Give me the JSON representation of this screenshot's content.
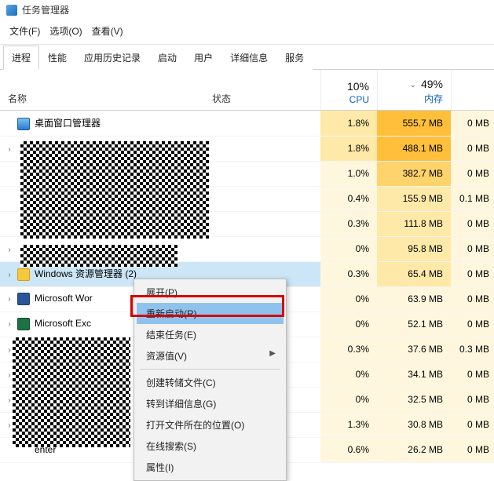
{
  "window": {
    "title": "任务管理器"
  },
  "menubar": {
    "file": "文件(F)",
    "options": "选项(O)",
    "view": "查看(V)"
  },
  "tabs": {
    "processes": "进程",
    "performance": "性能",
    "app_history": "应用历史记录",
    "startup": "启动",
    "users": "用户",
    "details": "详细信息",
    "services": "服务"
  },
  "columns": {
    "name": "名称",
    "status": "状态",
    "cpu_pct": "10%",
    "cpu_label": "CPU",
    "mem_pct": "49%",
    "mem_label": "内存"
  },
  "processes": [
    {
      "name": "桌面窗口管理器",
      "icon": "desktop",
      "exp": "",
      "cpu": "1.8%",
      "mem": "555.7 MB",
      "disk": "0 MB",
      "cpu_heat": "heat-mid",
      "mem_heat": "heat-vhigh",
      "disk_heat": "heat-low"
    },
    {
      "name": "",
      "icon": "",
      "exp": "›",
      "cpu": "1.8%",
      "mem": "488.1 MB",
      "disk": "0 MB",
      "cpu_heat": "heat-mid",
      "mem_heat": "heat-vhigh",
      "disk_heat": "heat-low"
    },
    {
      "name": "",
      "icon": "",
      "exp": "",
      "cpu": "1.0%",
      "mem": "382.7 MB",
      "disk": "0 MB",
      "cpu_heat": "heat-low",
      "mem_heat": "heat-high",
      "disk_heat": "heat-low"
    },
    {
      "name": "",
      "icon": "",
      "exp": "",
      "cpu": "0.4%",
      "mem": "155.9 MB",
      "disk": "0.1 MB",
      "cpu_heat": "heat-low",
      "mem_heat": "heat-mid",
      "disk_heat": "heat-low"
    },
    {
      "name": "",
      "icon": "",
      "exp": "",
      "cpu": "0.3%",
      "mem": "111.8 MB",
      "disk": "0 MB",
      "cpu_heat": "heat-low",
      "mem_heat": "heat-mid",
      "disk_heat": "heat-low"
    },
    {
      "name": "",
      "icon": "",
      "exp": "›",
      "cpu": "0%",
      "mem": "95.8 MB",
      "disk": "0 MB",
      "cpu_heat": "heat-low",
      "mem_heat": "heat-mid",
      "disk_heat": "heat-low"
    },
    {
      "name": "Windows 资源管理器 (2)",
      "icon": "explorer",
      "exp": "›",
      "cpu": "0.3%",
      "mem": "65.4 MB",
      "disk": "0 MB",
      "cpu_heat": "heat-low",
      "mem_heat": "heat-mid",
      "disk_heat": "heat-low"
    },
    {
      "name": "Microsoft Wor",
      "icon": "word",
      "exp": "›",
      "cpu": "0%",
      "mem": "63.9 MB",
      "disk": "0 MB",
      "cpu_heat": "heat-low",
      "mem_heat": "heat-low",
      "disk_heat": "heat-low"
    },
    {
      "name": "Microsoft Exc",
      "icon": "excel",
      "exp": "›",
      "cpu": "0%",
      "mem": "52.1 MB",
      "disk": "0 MB",
      "cpu_heat": "heat-low",
      "mem_heat": "heat-low",
      "disk_heat": "heat-low"
    },
    {
      "name": "",
      "icon": "",
      "exp": "›",
      "cpu": "0.3%",
      "mem": "37.6 MB",
      "disk": "0.3 MB",
      "cpu_heat": "heat-low",
      "mem_heat": "heat-low",
      "disk_heat": "heat-low"
    },
    {
      "name": "",
      "icon": "",
      "exp": "›",
      "cpu": "0%",
      "mem": "34.1 MB",
      "disk": "0 MB",
      "cpu_heat": "heat-low",
      "mem_heat": "heat-low",
      "disk_heat": "heat-low"
    },
    {
      "name": "",
      "icon": "",
      "exp": "›",
      "cpu": "0%",
      "mem": "32.5 MB",
      "disk": "0 MB",
      "cpu_heat": "heat-low",
      "mem_heat": "heat-low",
      "disk_heat": "heat-low"
    },
    {
      "name": "",
      "icon": "",
      "exp": "›",
      "cpu": "1.3%",
      "mem": "30.8 MB",
      "disk": "0 MB",
      "cpu_heat": "heat-low",
      "mem_heat": "heat-low",
      "disk_heat": "heat-low"
    },
    {
      "name": "enter",
      "icon": "",
      "exp": "",
      "cpu": "0.6%",
      "mem": "26.2 MB",
      "disk": "0 MB",
      "cpu_heat": "heat-low",
      "mem_heat": "heat-low",
      "disk_heat": "heat-low"
    }
  ],
  "context_menu": {
    "expand": "展开(P)",
    "restart": "重新启动(R)",
    "end_task": "结束任务(E)",
    "resource_values": "资源值(V)",
    "create_dump": "创建转储文件(C)",
    "go_to_details": "转到详细信息(G)",
    "open_file_location": "打开文件所在的位置(O)",
    "search_online": "在线搜索(S)",
    "properties": "属性(I)"
  }
}
